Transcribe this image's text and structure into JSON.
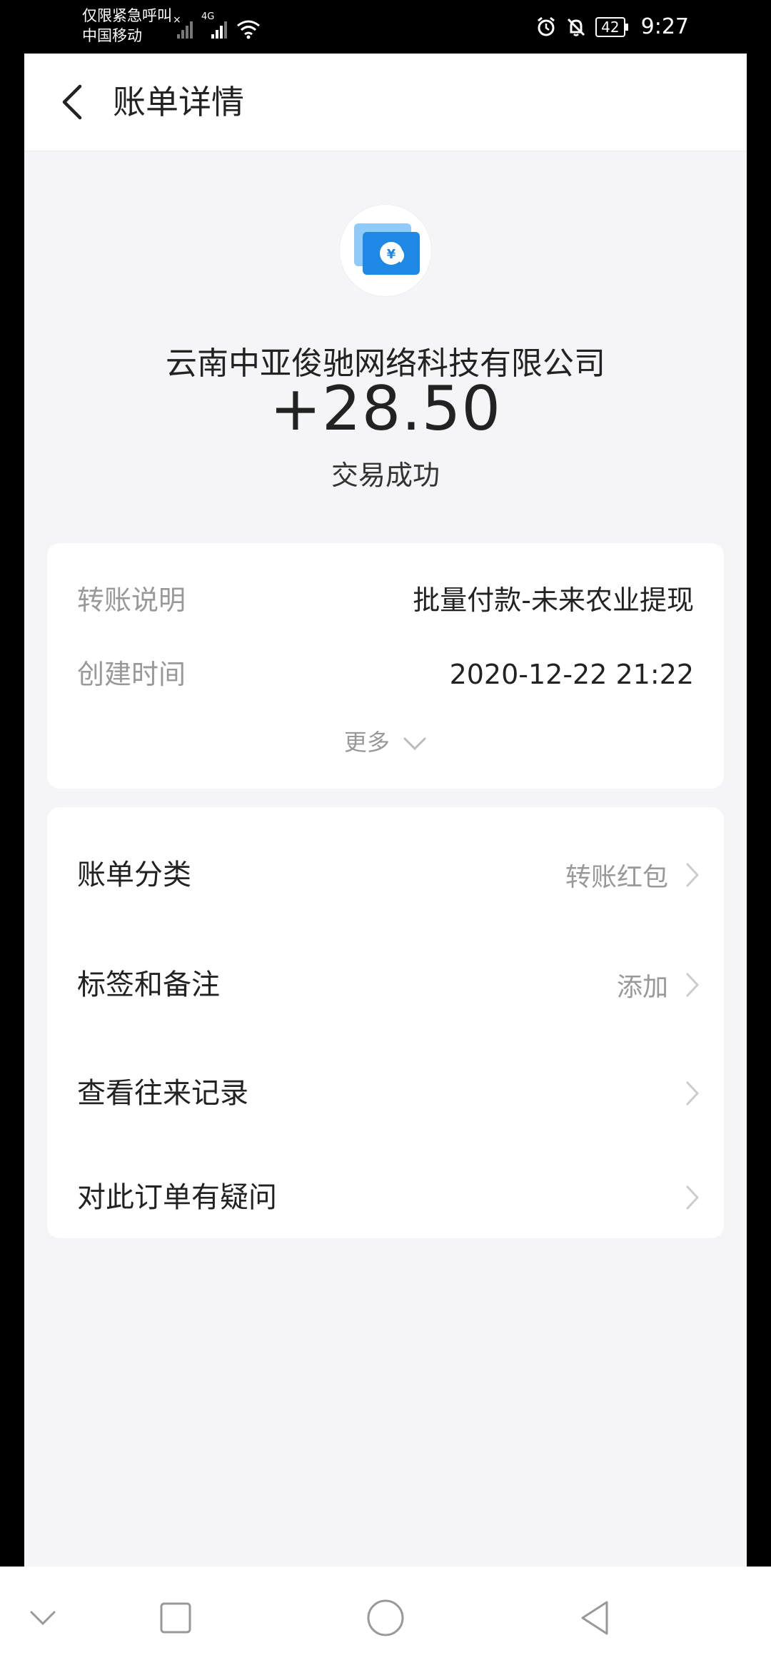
{
  "status_bar": {
    "carrier_line1": "仅限紧急呼叫",
    "carrier_line2": "中国移动",
    "network": "4G",
    "battery": "42",
    "time": "9:27"
  },
  "header": {
    "title": "账单详情"
  },
  "transaction": {
    "merchant": "云南中亚俊驰网络科技有限公司",
    "amount": "+28.50",
    "status": "交易成功"
  },
  "details": {
    "transfer_label": "转账说明",
    "transfer_value": "批量付款-未来农业提现",
    "time_label": "创建时间",
    "time_value": "2020-12-22 21:22",
    "more_label": "更多"
  },
  "menu": {
    "items": [
      {
        "label": "账单分类",
        "value": "转账红包"
      },
      {
        "label": "标签和备注",
        "value": "添加"
      },
      {
        "label": "查看往来记录",
        "value": ""
      },
      {
        "label": "对此订单有疑问",
        "value": ""
      }
    ]
  },
  "colors": {
    "logo_blue": "#1e88e5",
    "logo_light": "#90caf9"
  }
}
